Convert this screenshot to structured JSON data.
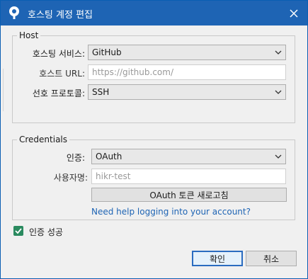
{
  "window": {
    "title": "호스팅 계정 편집"
  },
  "host": {
    "legend": "Host",
    "service_label": "호스팅 서비스:",
    "service_value": "GitHub",
    "url_label": "호스트 URL:",
    "url_placeholder": "https://github.com/",
    "protocol_label": "선호 프로토콜:",
    "protocol_value": "SSH"
  },
  "credentials": {
    "legend": "Credentials",
    "auth_label": "인증:",
    "auth_value": "OAuth",
    "username_label": "사용자명:",
    "username_placeholder": "hikr-test",
    "refresh_token_label": "OAuth 토큰 새로고침",
    "help_link": "Need help logging into your account?"
  },
  "auth_status": {
    "label": "인증 성공",
    "checked": true
  },
  "buttons": {
    "ok_label": "확인",
    "cancel_label": "취소"
  },
  "colors": {
    "titlebar": "#1e64b4",
    "link": "#1e64b4",
    "check": "#2a8a5f"
  },
  "icons": {
    "app": "sourcetree-icon",
    "close": "close-icon",
    "dropdown": "chevron-down-icon",
    "check": "checkmark-icon"
  }
}
